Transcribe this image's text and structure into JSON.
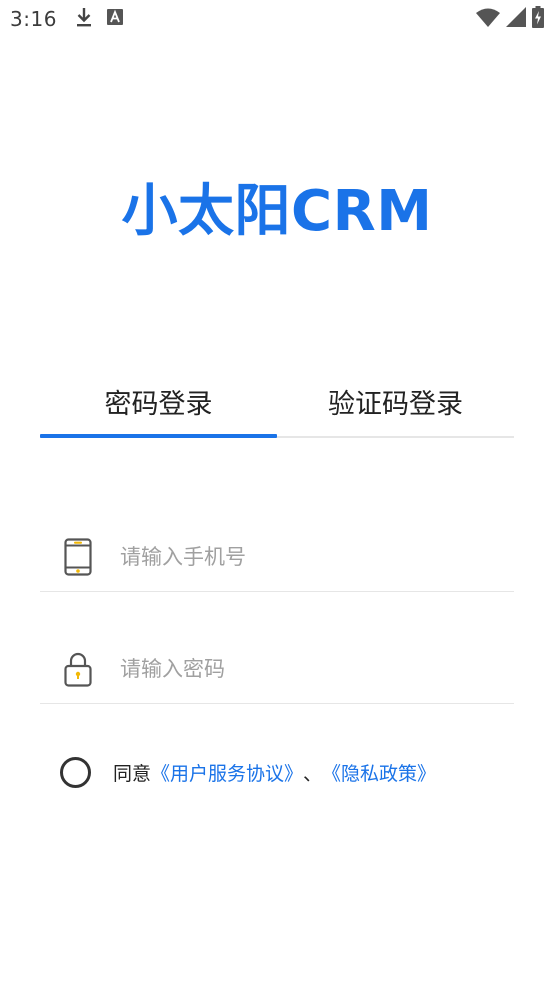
{
  "status_bar": {
    "time": "3:16",
    "icons": [
      "download-icon",
      "keyboard-a-icon",
      "wifi-icon",
      "signal-icon",
      "battery-icon"
    ]
  },
  "app": {
    "title": "小太阳CRM",
    "accent_color": "#1a73e8"
  },
  "tabs": [
    {
      "label": "密码登录",
      "active": true
    },
    {
      "label": "验证码登录",
      "active": false
    }
  ],
  "form": {
    "phone": {
      "placeholder": "请输入手机号",
      "value": "",
      "icon": "phone-icon"
    },
    "password": {
      "placeholder": "请输入密码",
      "value": "",
      "icon": "lock-icon"
    }
  },
  "agreement": {
    "checked": false,
    "prefix": "同意",
    "terms_link": "《用户服务协议》",
    "separator": "、",
    "privacy_link": "《隐私政策》"
  }
}
